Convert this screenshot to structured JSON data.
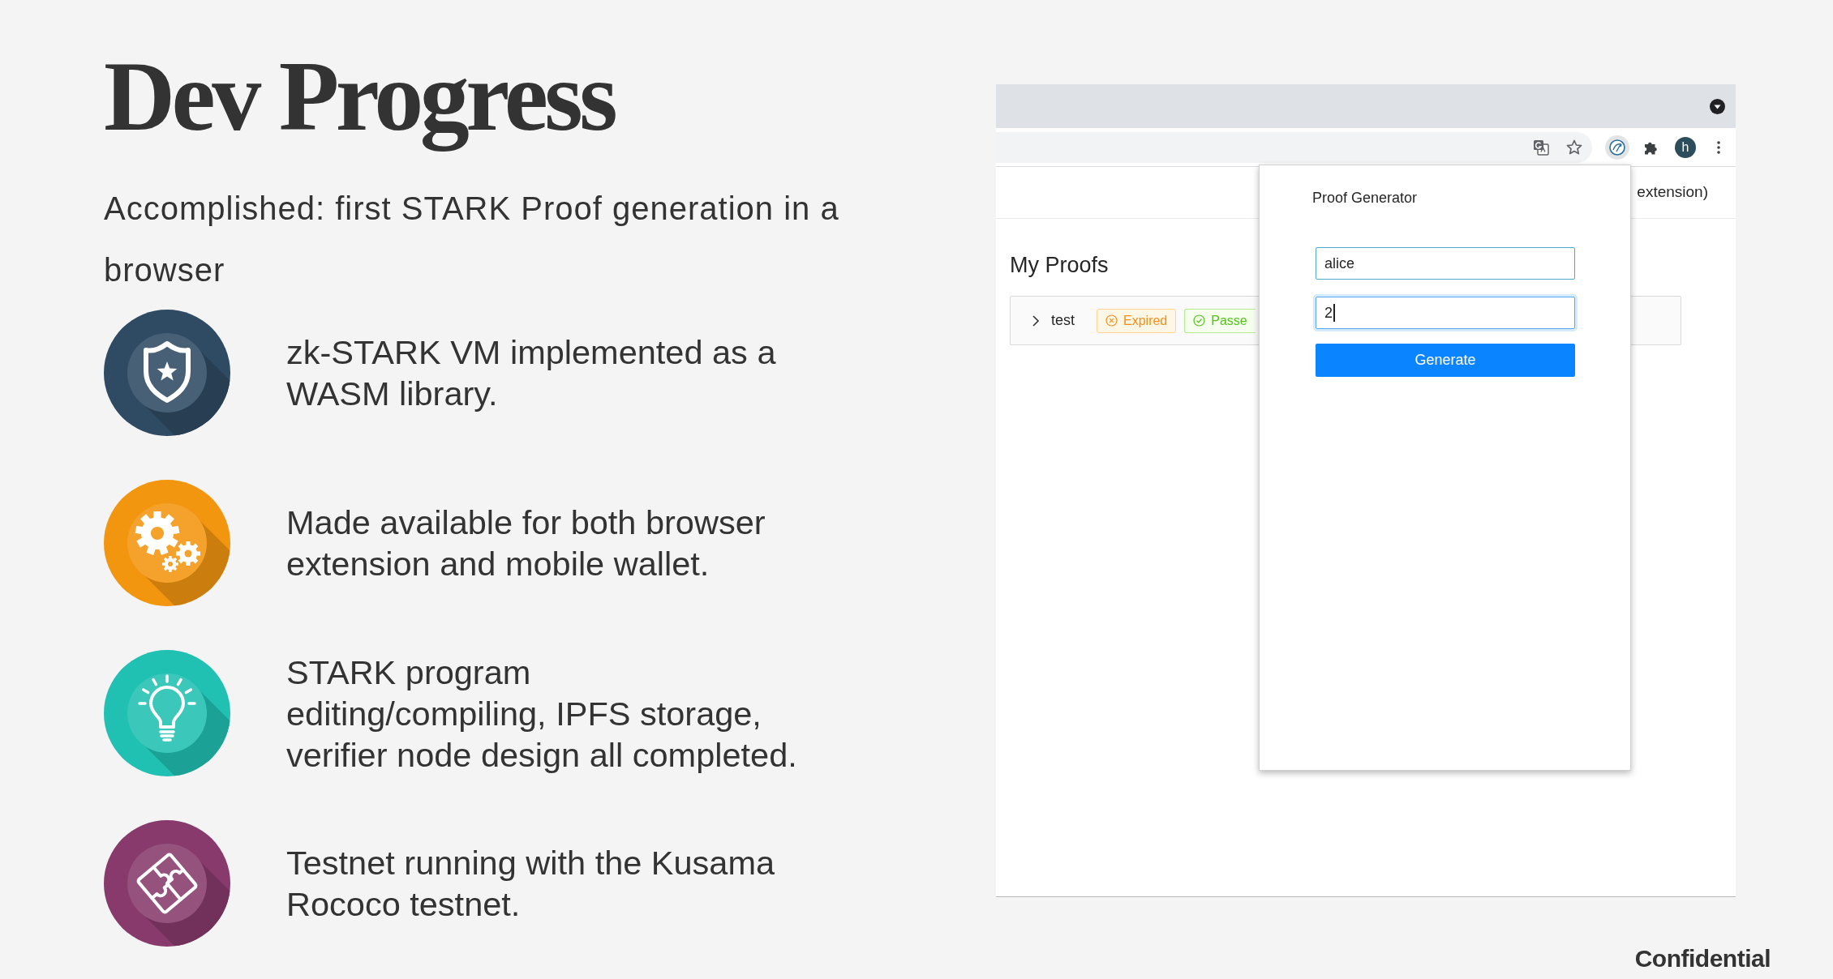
{
  "title": "Dev Progress",
  "subtitle": "Accomplished: first STARK Proof generation in a browser",
  "items": [
    {
      "text": "zk-STARK VM implemented as a WASM library.",
      "color": "#2f4a63"
    },
    {
      "text": "Made available for both browser extension and mobile wallet.",
      "color": "#f2950f"
    },
    {
      "text": "STARK program editing/compiling, IPFS storage, verifier node design all completed.",
      "color": "#20c0b2"
    },
    {
      "text": "Testnet running with the Kusama Rococo testnet.",
      "color": "#873a6b"
    }
  ],
  "screenshot": {
    "toolbar": {
      "profile_initial": "h"
    },
    "page": {
      "header_text": "extension)",
      "heading": "My Proofs",
      "proofs": [
        {
          "name": "test",
          "expanded": false,
          "tags": [
            {
              "kind": "expired",
              "label": "Expired"
            },
            {
              "kind": "passed",
              "label": "Passe"
            }
          ]
        }
      ]
    },
    "popup": {
      "title": "Proof Generator",
      "fields": [
        {
          "value": "alice",
          "focused": false
        },
        {
          "value": "2",
          "focused": true
        }
      ],
      "button": "Generate"
    }
  },
  "footer": "Confidential"
}
